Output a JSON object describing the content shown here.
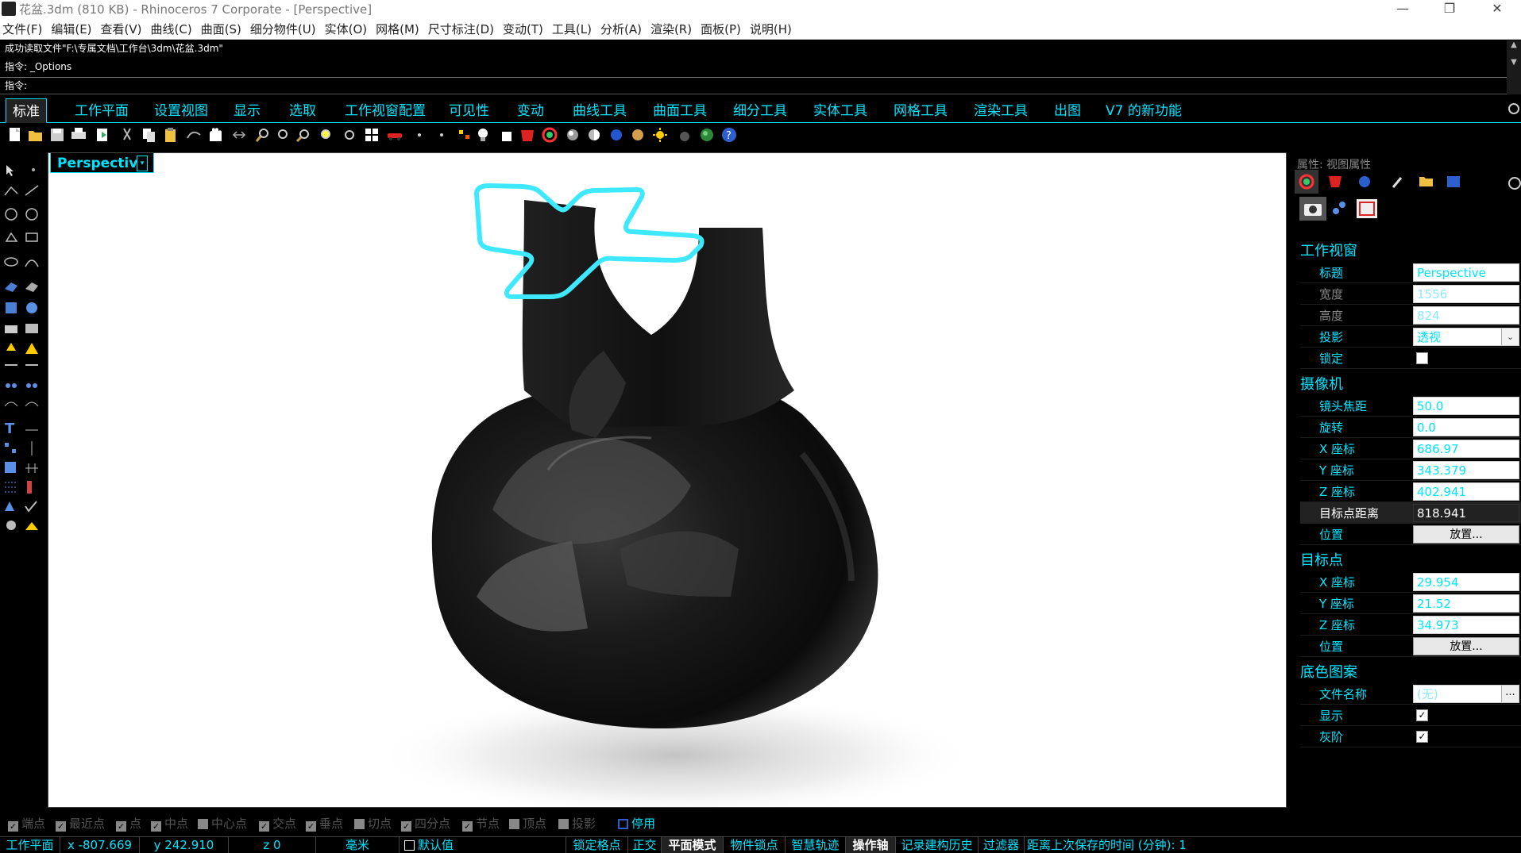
{
  "window": {
    "title": "花盆.3dm (810 KB) - Rhinoceros 7 Corporate - [Perspective]"
  },
  "menu": [
    "文件(F)",
    "编辑(E)",
    "查看(V)",
    "曲线(C)",
    "曲面(S)",
    "细分物件(U)",
    "实体(O)",
    "网格(M)",
    "尺寸标注(D)",
    "变动(T)",
    "工具(L)",
    "分析(A)",
    "渲染(R)",
    "面板(P)",
    "说明(H)"
  ],
  "command": {
    "history": [
      "成功读取文件\"F:\\专属文档\\工作台\\3dm\\花盆.3dm\"",
      "指令: _Options"
    ],
    "prompt": "指令:"
  },
  "tabs": [
    "标准",
    "工作平面",
    "设置视图",
    "显示",
    "选取",
    "工作视窗配置",
    "可见性",
    "变动",
    "曲线工具",
    "曲面工具",
    "细分工具",
    "实体工具",
    "网格工具",
    "渲染工具",
    "出图",
    "V7 的新功能"
  ],
  "viewport": {
    "name": "Perspective",
    "dropdown": "▾"
  },
  "panel": {
    "title": "属性: 视图属性",
    "sections": {
      "viewport": "工作视窗",
      "camera": "摄像机",
      "target": "目标点",
      "wallpaper": "底色图案"
    },
    "viewport_rows": {
      "title_label": "标题",
      "title_value": "Perspective",
      "width_label": "宽度",
      "width_value": "1556",
      "height_label": "高度",
      "height_value": "824",
      "projection_label": "投影",
      "projection_value": "透视",
      "lock_label": "锁定"
    },
    "camera_rows": {
      "lens_label": "镜头焦距",
      "lens_value": "50.0",
      "rotate_label": "旋转",
      "rotate_value": "0.0",
      "x_label": "X 座标",
      "x_value": "686.97",
      "y_label": "Y 座标",
      "y_value": "343.379",
      "z_label": "Z 座标",
      "z_value": "402.941",
      "dist_label": "目标点距离",
      "dist_value": "818.941",
      "pos_label": "位置",
      "pos_button": "放置..."
    },
    "target_rows": {
      "x_label": "X 座标",
      "x_value": "29.954",
      "y_label": "Y 座标",
      "y_value": "21.52",
      "z_label": "Z 座标",
      "z_value": "34.973",
      "pos_label": "位置",
      "pos_button": "放置..."
    },
    "wallpaper_rows": {
      "file_label": "文件名称",
      "file_value": "(无)",
      "file_button": "...",
      "show_label": "显示",
      "gray_label": "灰阶"
    }
  },
  "osnap": {
    "items": [
      "端点",
      "最近点",
      "点",
      "中点",
      "中心点",
      "交点",
      "垂点",
      "切点",
      "四分点",
      "节点",
      "顶点",
      "投影",
      "停用"
    ],
    "check": "✓"
  },
  "status": {
    "cplane": "工作平面",
    "x": "x -807.669",
    "y": "y 242.910",
    "z": "z 0",
    "units": "毫米",
    "layer": "默认值",
    "items": [
      "锁定格点",
      "正交",
      "平面模式",
      "物件锁点",
      "智慧轨迹",
      "操作轴",
      "记录建构历史",
      "过滤器",
      "距离上次保存的时间 (分钟): 1"
    ]
  },
  "colors": {
    "accent": "#00e5ff",
    "object": "#1a1a1a",
    "highlight": "#3ee8ff"
  }
}
